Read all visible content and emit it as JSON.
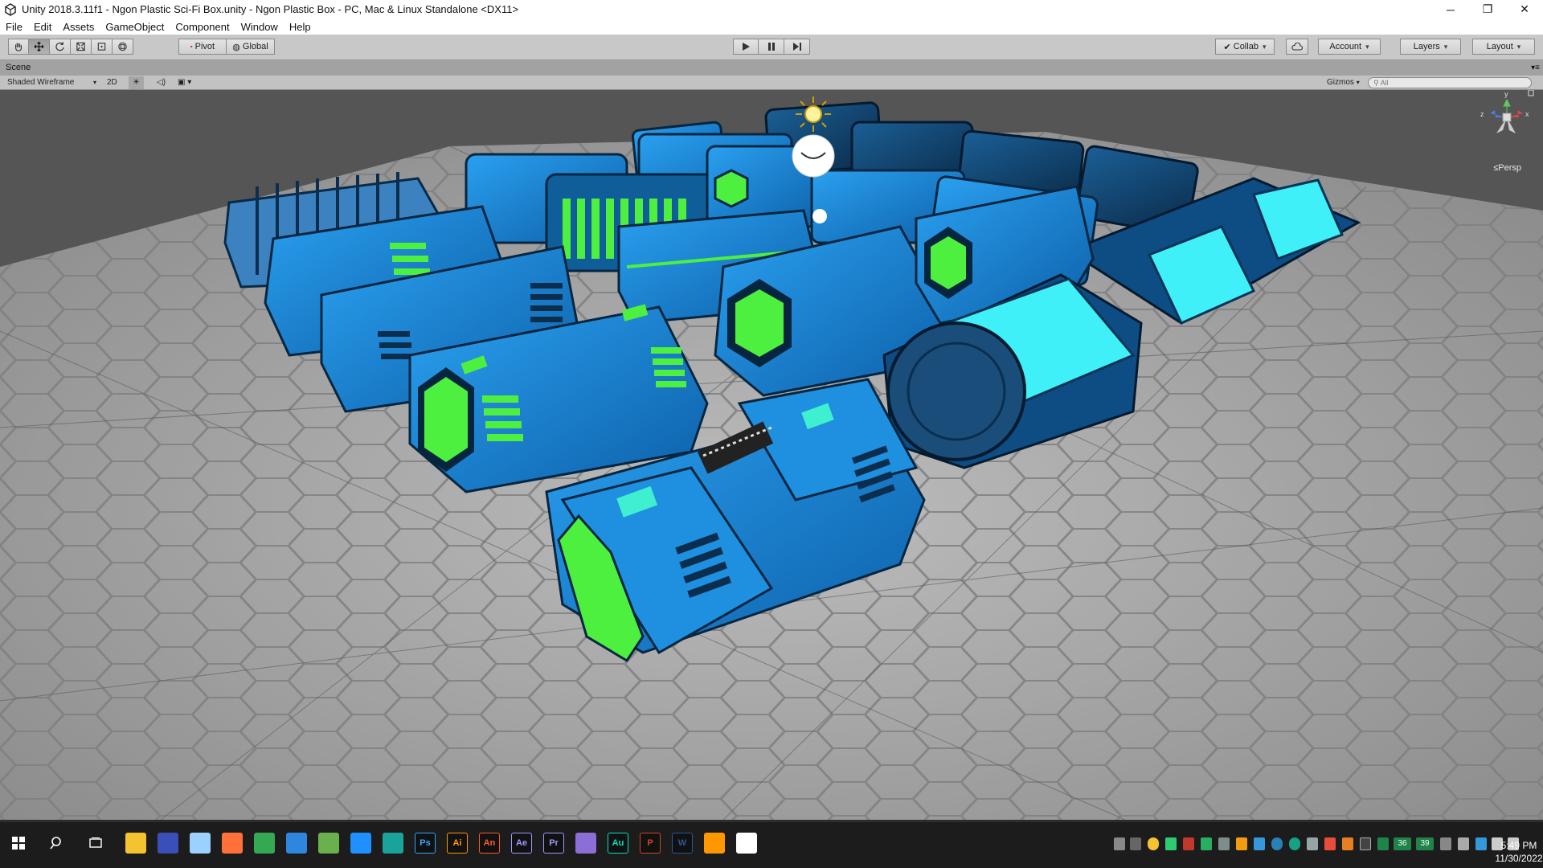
{
  "window": {
    "title": "Unity 2018.3.11f1 - Ngon Plastic Sci-Fi Box.unity - Ngon Plastic Box - PC, Mac & Linux Standalone <DX11>",
    "controls": {
      "minimize": "─",
      "maximize": "❐",
      "close": "✕"
    }
  },
  "menu": [
    "File",
    "Edit",
    "Assets",
    "GameObject",
    "Component",
    "Window",
    "Help"
  ],
  "toolbar": {
    "tools": [
      "hand-tool",
      "move-tool",
      "rotate-tool",
      "scale-tool",
      "rect-tool",
      "transform-tool"
    ],
    "active_tool": "move-tool",
    "pivot_label": "Pivot",
    "global_label": "Global",
    "collab_label": "Collab",
    "account_label": "Account",
    "layers_label": "Layers",
    "layout_label": "Layout"
  },
  "scene": {
    "tab_label": "Scene",
    "draw_mode": "Shaded Wireframe",
    "mode_2d": "2D",
    "gizmos_label": "Gizmos",
    "search_placeholder": "All",
    "projection_label": "Persp",
    "gizmo_axes": {
      "y": "y",
      "x": "x",
      "z": "z"
    }
  },
  "colors": {
    "unity_toolbar": "#c8c8c8",
    "floor": "#a9a9a9",
    "box_blue": "#1a8ce0",
    "box_green": "#4ef040",
    "box_cyan": "#3ff0f8",
    "taskbar": "#1c1c1c"
  },
  "taskbar": {
    "pinned": [
      {
        "name": "explorer-icon",
        "label": "",
        "color": "#f4c430"
      },
      {
        "name": "archive-icon",
        "label": "",
        "color": "#3b4fb8"
      },
      {
        "name": "paint-icon",
        "label": "",
        "color": "#9bd0ff"
      },
      {
        "name": "firefox-icon",
        "label": "",
        "color": "#ff7139"
      },
      {
        "name": "chrome-icon",
        "label": "",
        "color": "#34a853"
      },
      {
        "name": "finder-icon",
        "label": "",
        "color": "#2e86de"
      },
      {
        "name": "globe-icon",
        "label": "",
        "color": "#6ab04c"
      },
      {
        "name": "globe-alt-icon",
        "label": "",
        "color": "#1e90ff"
      },
      {
        "name": "maya-icon",
        "label": "",
        "color": "#1aa39a"
      },
      {
        "name": "photoshop-icon",
        "label": "Ps",
        "color": "#31a8ff"
      },
      {
        "name": "illustrator-icon",
        "label": "Ai",
        "color": "#ff9a00"
      },
      {
        "name": "animate-icon",
        "label": "An",
        "color": "#ff5c2b"
      },
      {
        "name": "after-effects-icon",
        "label": "Ae",
        "color": "#9999ff"
      },
      {
        "name": "premiere-icon",
        "label": "Pr",
        "color": "#9999ff"
      },
      {
        "name": "substance-icon",
        "label": "",
        "color": "#8b6fd6"
      },
      {
        "name": "audition-icon",
        "label": "Au",
        "color": "#00e4bb"
      },
      {
        "name": "powerpoint-icon",
        "label": "P",
        "color": "#d24726"
      },
      {
        "name": "word-icon",
        "label": "W",
        "color": "#2b579a"
      },
      {
        "name": "sublime-icon",
        "label": "",
        "color": "#ff9800"
      },
      {
        "name": "unity-icon",
        "label": "",
        "color": "#ffffff"
      }
    ],
    "tray_counts": [
      "36",
      "39"
    ],
    "time": "5:49 PM",
    "date": "11/30/2022"
  }
}
